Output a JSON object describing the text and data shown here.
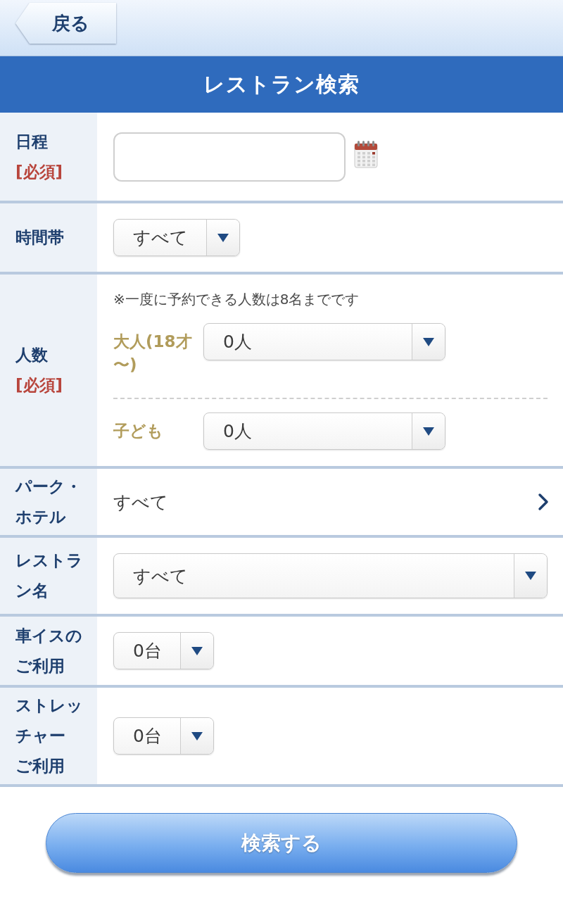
{
  "top_bar": {
    "back_button": "戻る"
  },
  "header": {
    "title": "レストラン検索"
  },
  "form": {
    "rows": [
      {
        "kind": "date",
        "label": "日程",
        "required_mark": "[必須]"
      },
      {
        "kind": "select",
        "label": "時間帯",
        "value": "すべて"
      },
      {
        "kind": "people",
        "label": "人数",
        "required_mark": "[必須]",
        "note": "※一度に予約できる人数は8名までです",
        "groups": [
          {
            "label": "大人(18才〜)",
            "value": "0人"
          },
          {
            "label": "子ども",
            "value": "0人"
          }
        ]
      },
      {
        "kind": "link",
        "label": "パーク・ホテル",
        "value": "すべて"
      },
      {
        "kind": "wide_select",
        "label": "レストラン名",
        "value": "すべて"
      },
      {
        "kind": "select",
        "label": "車イスのご利用",
        "value": "0台"
      },
      {
        "kind": "select",
        "label": [
          "ストレッチャー",
          "ご利用"
        ],
        "value": "0台"
      }
    ]
  },
  "search_button": "検索する"
}
